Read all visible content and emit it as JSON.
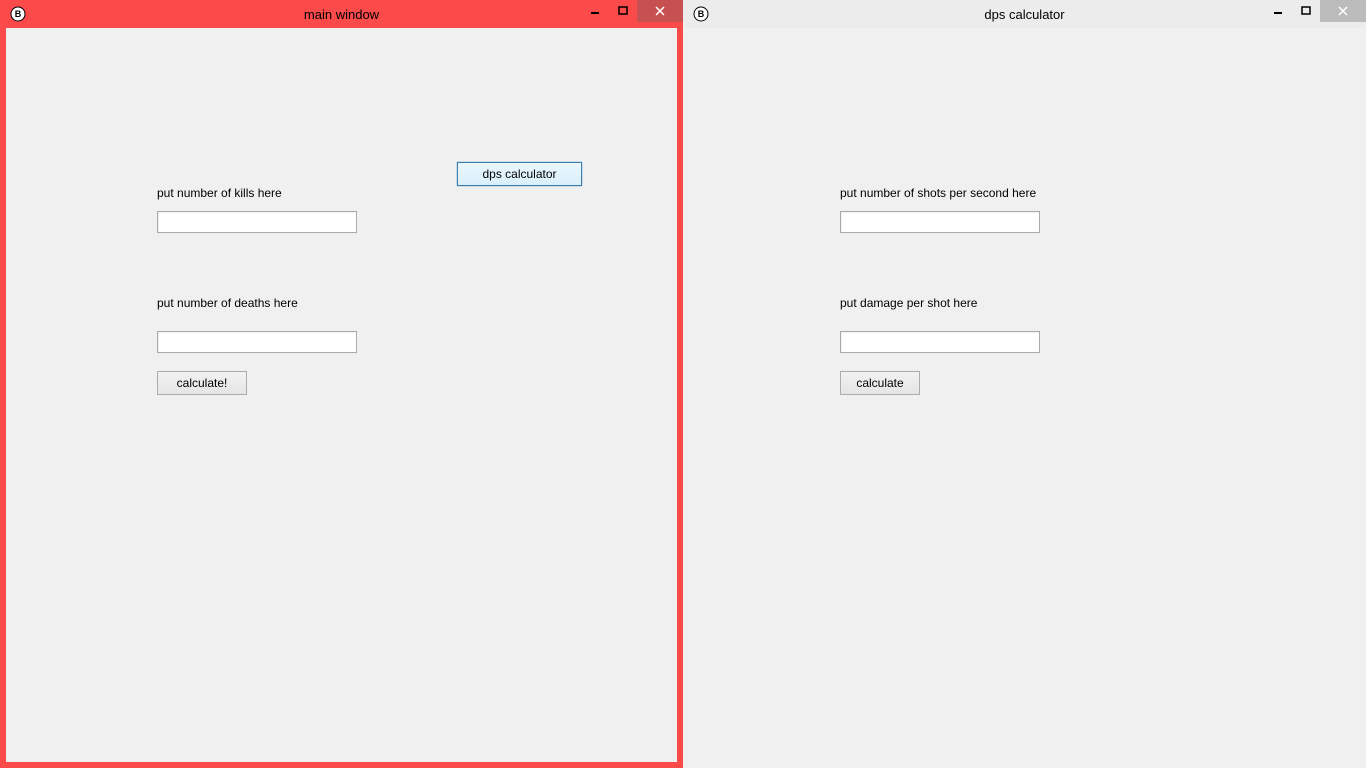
{
  "window_left": {
    "title": "main window",
    "label_kills": "put number of kills here",
    "input_kills": "",
    "label_deaths": "put number of deaths here",
    "input_deaths": "",
    "calculate_button": "calculate!",
    "dps_calculator_button": "dps calculator"
  },
  "window_right": {
    "title": "dps calculator",
    "label_shots": "put number of shots per second here",
    "input_shots": "",
    "label_damage": "put damage per shot here",
    "input_damage": "",
    "calculate_button": "calculate"
  }
}
